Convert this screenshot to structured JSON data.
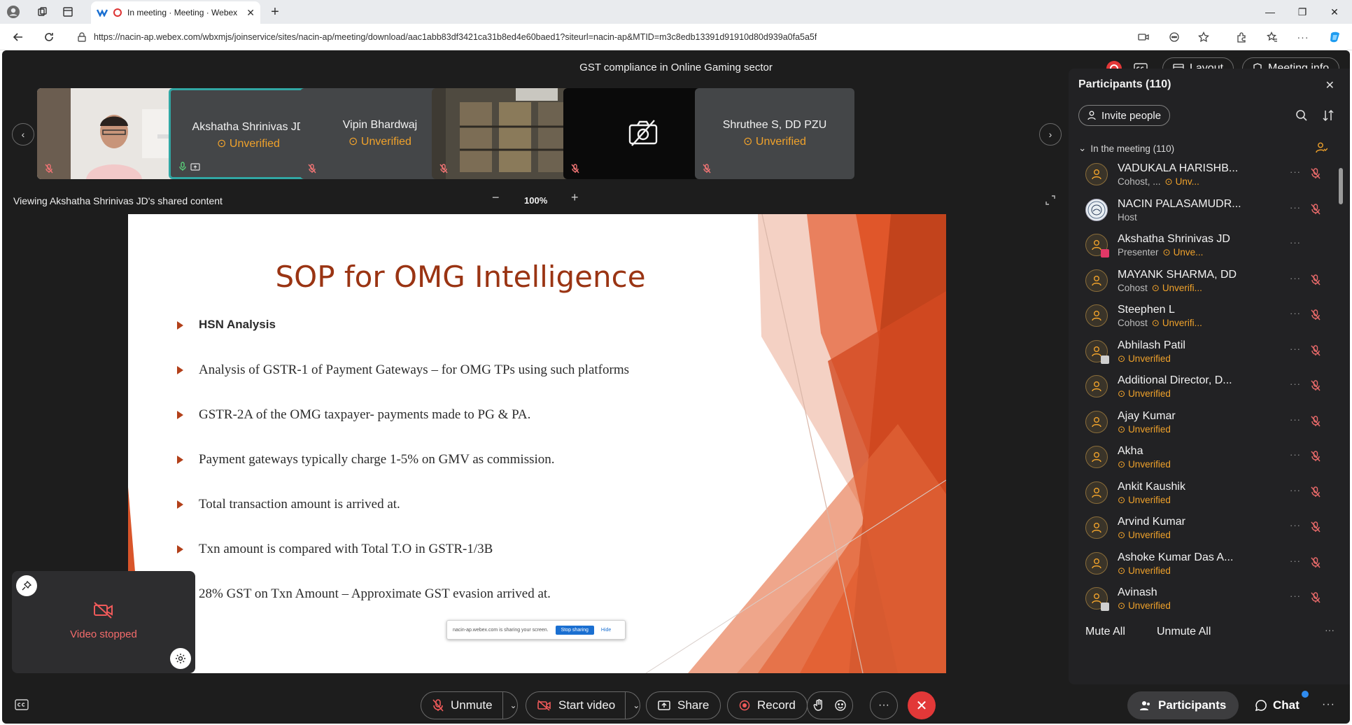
{
  "browser": {
    "tab_title": "In meeting · Meeting · Webex",
    "url": "https://nacin-ap.webex.com/wbxmjs/joinservice/sites/nacin-ap/meeting/download/aac1abb83df3421ca31b8ed4e60baed1?siteurl=nacin-ap&MTID=m3c8edb13391d91910d80d939a0fa5a5f"
  },
  "meeting": {
    "title": "GST compliance in Online Gaming sector",
    "layout_label": "Layout",
    "info_label": "Meeting info",
    "viewing_text": "Viewing Akshatha Shrinivas JD's shared content",
    "zoom_level": "100%"
  },
  "video_strip": [
    {
      "name": "",
      "status": "",
      "kind": "camera"
    },
    {
      "name": "Akshatha Shrinivas JD",
      "status": "Unverified",
      "kind": "active"
    },
    {
      "name": "Vipin Bhardwaj",
      "status": "Unverified",
      "kind": "name"
    },
    {
      "name": "",
      "status": "",
      "kind": "camera-room"
    },
    {
      "name": "",
      "status": "",
      "kind": "video-off"
    },
    {
      "name": "Shruthee S, DD PZU",
      "status": "Unverified",
      "kind": "name"
    }
  ],
  "slide": {
    "title": "SOP for OMG Intelligence",
    "bullets": [
      "HSN Analysis",
      "Analysis of GSTR-1 of Payment Gateways – for OMG TPs using such platforms",
      "GSTR-2A of the OMG taxpayer- payments made to PG & PA.",
      "Payment gateways typically charge 1-5% on GMV as commission.",
      "Total transaction amount is arrived at.",
      "Txn amount is compared with Total T.O in GSTR-1/3B",
      "28% GST on Txn Amount – Approximate GST evasion arrived at."
    ],
    "share_notice": "nacin-ap.webex.com is sharing your screen.",
    "stop_sharing": "Stop sharing",
    "hide": "Hide"
  },
  "self_view": {
    "status": "Video stopped"
  },
  "toolbar": {
    "unmute": "Unmute",
    "start_video": "Start video",
    "share": "Share",
    "record": "Record",
    "participants": "Participants",
    "chat": "Chat"
  },
  "panel": {
    "title": "Participants (110)",
    "invite": "Invite people",
    "section": "In the meeting (110)",
    "mute_all": "Mute All",
    "unmute_all": "Unmute All",
    "participants": [
      {
        "name": "VADUKALA HARISHB...",
        "role": "Cohost, ...",
        "status": "Unv...",
        "avatar": "person",
        "muted": true
      },
      {
        "name": "NACIN PALASAMUDR...",
        "role": "Host",
        "status": "",
        "avatar": "host",
        "muted": true
      },
      {
        "name": "Akshatha Shrinivas JD",
        "role": "Presenter",
        "status": "Unve...",
        "avatar": "presenter",
        "muted": false
      },
      {
        "name": "MAYANK SHARMA, DD",
        "role": "Cohost",
        "status": "Unverifi...",
        "avatar": "person",
        "muted": true
      },
      {
        "name": "Steephen L",
        "role": "Cohost",
        "status": "Unverifi...",
        "avatar": "person",
        "muted": true
      },
      {
        "name": "Abhilash Patil",
        "role": "",
        "status": "Unverified",
        "avatar": "device",
        "muted": true
      },
      {
        "name": "Additional Director, D...",
        "role": "",
        "status": "Unverified",
        "avatar": "person",
        "muted": true
      },
      {
        "name": "Ajay Kumar",
        "role": "",
        "status": "Unverified",
        "avatar": "person",
        "muted": true
      },
      {
        "name": "Akha",
        "role": "",
        "status": "Unverified",
        "avatar": "person",
        "muted": true
      },
      {
        "name": "Ankit Kaushik",
        "role": "",
        "status": "Unverified",
        "avatar": "person",
        "muted": true
      },
      {
        "name": "Arvind Kumar",
        "role": "",
        "status": "Unverified",
        "avatar": "person",
        "muted": true
      },
      {
        "name": "Ashoke Kumar Das A...",
        "role": "",
        "status": "Unverified",
        "avatar": "person",
        "muted": true
      },
      {
        "name": "Avinash",
        "role": "",
        "status": "Unverified",
        "avatar": "device",
        "muted": true
      }
    ]
  },
  "colors": {
    "accent_unverified": "#f0a22b",
    "leave_red": "#e23838",
    "slide_title": "#9a3413",
    "active_tile_border": "#31a7a4"
  }
}
